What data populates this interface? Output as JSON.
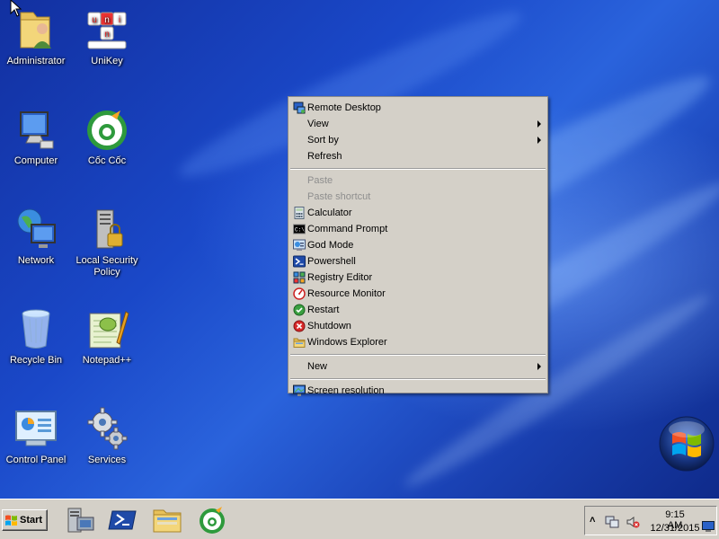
{
  "desktop": {
    "icons": [
      {
        "label": "Administrator"
      },
      {
        "label": "UniKey"
      },
      {
        "label": "Computer"
      },
      {
        "label": "Cốc Cốc"
      },
      {
        "label": "Network"
      },
      {
        "label": "Local Security Policy"
      },
      {
        "label": "Recycle Bin"
      },
      {
        "label": "Notepad++"
      },
      {
        "label": "Control Panel"
      },
      {
        "label": "Services"
      }
    ]
  },
  "context_menu": {
    "items": [
      {
        "label": "Remote Desktop",
        "icon": "remote-desktop-icon"
      },
      {
        "label": "View",
        "submenu": true
      },
      {
        "label": "Sort by",
        "submenu": true
      },
      {
        "label": "Refresh"
      },
      {
        "label": "Paste",
        "disabled": true
      },
      {
        "label": "Paste shortcut",
        "disabled": true
      },
      {
        "label": "Calculator",
        "icon": "calculator-icon"
      },
      {
        "label": "Command Prompt",
        "icon": "command-prompt-icon"
      },
      {
        "label": "God Mode",
        "icon": "god-mode-icon"
      },
      {
        "label": "Powershell",
        "icon": "powershell-icon"
      },
      {
        "label": "Registry Editor",
        "icon": "registry-editor-icon"
      },
      {
        "label": "Resource Monitor",
        "icon": "resource-monitor-icon"
      },
      {
        "label": "Restart",
        "icon": "restart-icon"
      },
      {
        "label": "Shutdown",
        "icon": "shutdown-icon"
      },
      {
        "label": "Windows Explorer",
        "icon": "windows-explorer-icon"
      },
      {
        "label": "New",
        "submenu": true
      },
      {
        "label": "Screen resolution",
        "icon": "screen-resolution-icon"
      }
    ]
  },
  "taskbar": {
    "start_label": "Start",
    "clock_time": "9:15 AM",
    "clock_date": "12/31/2015",
    "tray_expand": "˄"
  },
  "colors": {
    "menu_bg": "#d4d0c8",
    "desktop_blue": "#1a48c8",
    "disabled_text": "#8e8e8e"
  }
}
